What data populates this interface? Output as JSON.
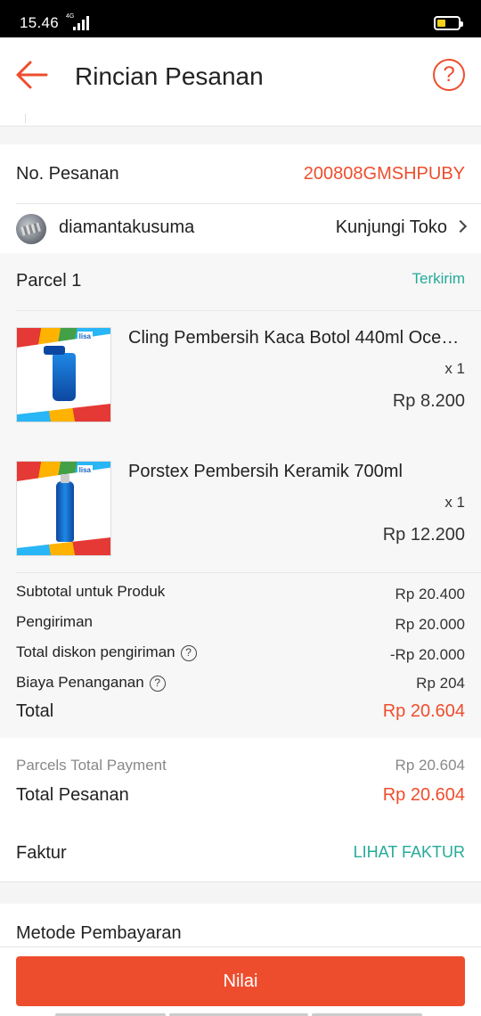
{
  "status_bar": {
    "time": "15.46",
    "network": "4G"
  },
  "header": {
    "title": "Rincian Pesanan",
    "help_symbol": "?"
  },
  "order": {
    "label": "No. Pesanan",
    "number": "200808GMSHPUBY"
  },
  "shop": {
    "name": "diamantakusuma",
    "visit_label": "Kunjungi Toko"
  },
  "parcel": {
    "title": "Parcel 1",
    "status": "Terkirim",
    "status_color": "#26aa99"
  },
  "products": [
    {
      "name": "Cling Pembersih Kaca Botol 440ml Oce…",
      "qty": "x 1",
      "price": "Rp 8.200"
    },
    {
      "name": "Porstex Pembersih Keramik 700ml",
      "qty": "x 1",
      "price": "Rp 12.200"
    }
  ],
  "thumb_logo": "lisa",
  "summary": {
    "subtotal_label": "Subtotal untuk Produk",
    "subtotal_value": "Rp 20.400",
    "shipping_label": "Pengiriman",
    "shipping_value": "Rp 20.000",
    "ship_discount_label": "Total diskon pengiriman",
    "ship_discount_value": "-Rp 20.000",
    "handling_label": "Biaya Penanganan",
    "handling_value": "Rp 204",
    "total_label": "Total",
    "total_value": "Rp 20.604"
  },
  "payment_summary": {
    "parcels_label": "Parcels Total Payment",
    "parcels_value": "Rp 20.604",
    "order_total_label": "Total Pesanan",
    "order_total_value": "Rp 20.604"
  },
  "invoice": {
    "label": "Faktur",
    "link": "LIHAT FAKTUR"
  },
  "payment_method": {
    "label": "Metode Pembayaran"
  },
  "cta": {
    "label": "Nilai"
  },
  "colors": {
    "accent": "#ee4d2d",
    "teal": "#26aa99"
  }
}
